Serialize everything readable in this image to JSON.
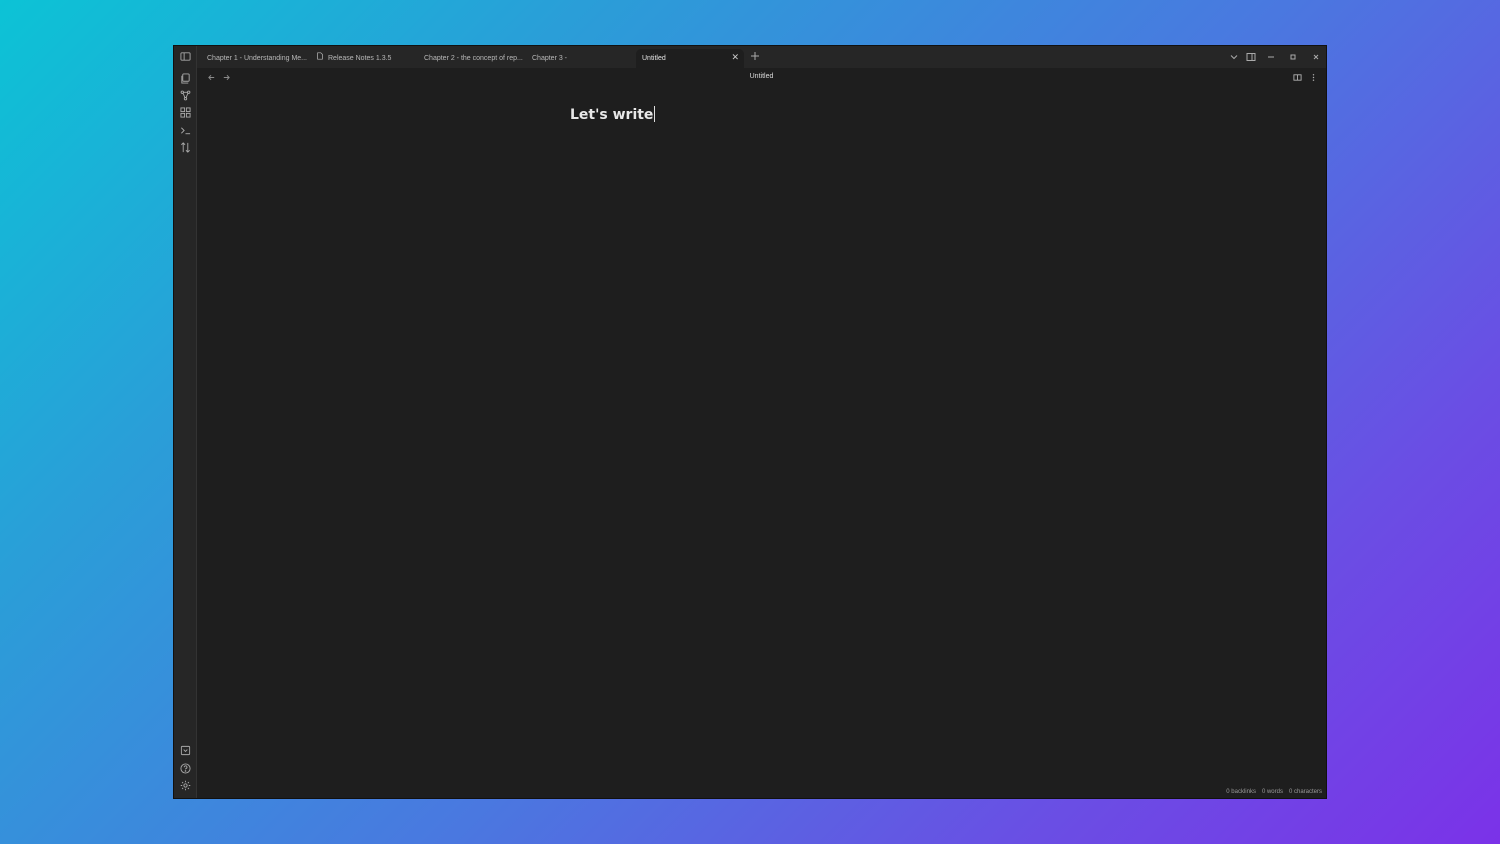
{
  "tabs": [
    {
      "label": "Chapter 1 - Understanding Me..."
    },
    {
      "label": "Release Notes 1.3.5"
    },
    {
      "label": "Chapter 2 - the concept of rep..."
    },
    {
      "label": "Chapter 3 -"
    },
    {
      "label": "Untitled"
    }
  ],
  "view": {
    "title": "Untitled"
  },
  "editor": {
    "title": "Let's write"
  },
  "status": {
    "backlinks": "0 backlinks",
    "words": "0 words",
    "characters": "0 characters"
  },
  "colors": {
    "background_start": "#0cc3d6",
    "background_end": "#7b32e8",
    "window": "#1e1e1e",
    "chrome": "#262626"
  },
  "icons": {
    "ribbon_top": [
      "sidebar-toggle-icon",
      "files-icon",
      "graph-icon",
      "canvas-icon",
      "terminal-icon",
      "sort-icon"
    ],
    "ribbon_bottom": [
      "vault-icon",
      "help-icon",
      "settings-icon"
    ],
    "tabbar": [
      "new-tab-icon",
      "tab-list-icon",
      "right-sidebar-icon",
      "minimize-icon",
      "maximize-icon",
      "close-window-icon"
    ],
    "view": [
      "back-icon",
      "forward-icon",
      "split-view-icon",
      "more-options-icon"
    ]
  }
}
